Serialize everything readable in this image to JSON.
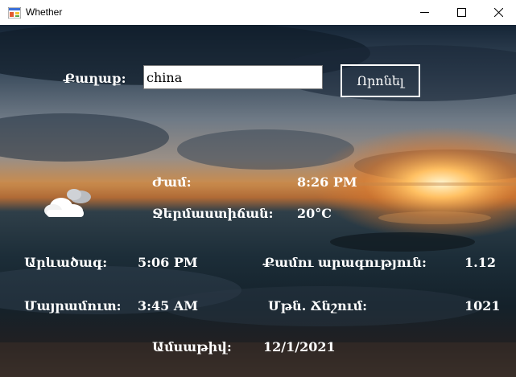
{
  "window": {
    "title": "Whether"
  },
  "form": {
    "city_label": "Քաղաք:",
    "city_value": "china",
    "search_button": "Որոնել"
  },
  "weather": {
    "icon": "partly-cloudy-night-icon",
    "time_label": "Ժամ:",
    "time_value": "8:26 PM",
    "temp_label": "Ջերմաստիճան:",
    "temp_value": "20°C",
    "sunrise_label": "Արևածագ:",
    "sunrise_value": "5:06 PM",
    "wind_label": "Քամու արագություն:",
    "wind_value": "1.12",
    "sunset_label": "Մայրամուտ:",
    "sunset_value": "3:45 AM",
    "pressure_label": "Մթն. Ճնշում:",
    "pressure_value": "1021",
    "date_label": "Ամսաթիվ:",
    "date_value": "12/1/2021"
  },
  "colors": {
    "label_text": "#ffffff",
    "titlebar": "#ffffff"
  }
}
